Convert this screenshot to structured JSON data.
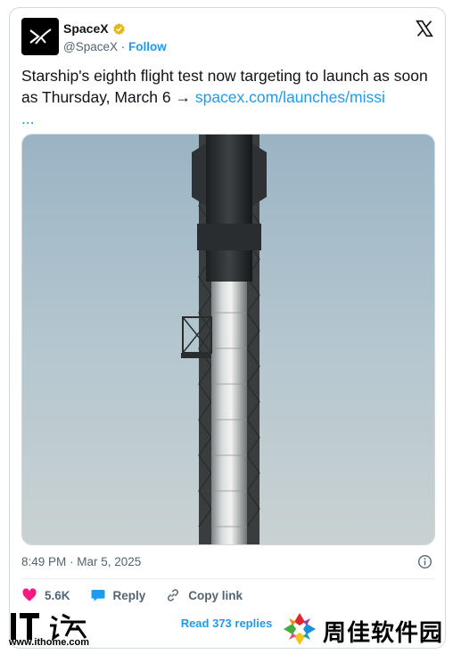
{
  "author": {
    "name": "SpaceX",
    "handle": "@SpaceX",
    "separator": "·",
    "follow_label": "Follow"
  },
  "tweet": {
    "text": "Starship's eighth flight test now targeting to launch as soon as Thursday, March 6 → ",
    "link": "spacex.com/launches/missi",
    "link_ellipsis": "..."
  },
  "meta": {
    "timestamp": "8:49 PM · Mar 5, 2025"
  },
  "actions": {
    "likes": "5.6K",
    "reply_label": "Reply",
    "copy_link_label": "Copy link"
  },
  "read_replies_label": "Read 373 replies",
  "watermarks": {
    "ithome_text": "IT之家",
    "ithome_url": "www.ithome.com",
    "zhoujia_text": "周佳软件园"
  },
  "colors": {
    "accent": "#1d9bf0",
    "like": "#f91880",
    "verified": "#e2b719",
    "text": "#0f1419",
    "muted": "#536471"
  },
  "icons": [
    "spacex-logo-icon",
    "verified-badge-icon",
    "x-logo-icon",
    "info-icon",
    "heart-icon",
    "reply-icon",
    "link-icon"
  ]
}
